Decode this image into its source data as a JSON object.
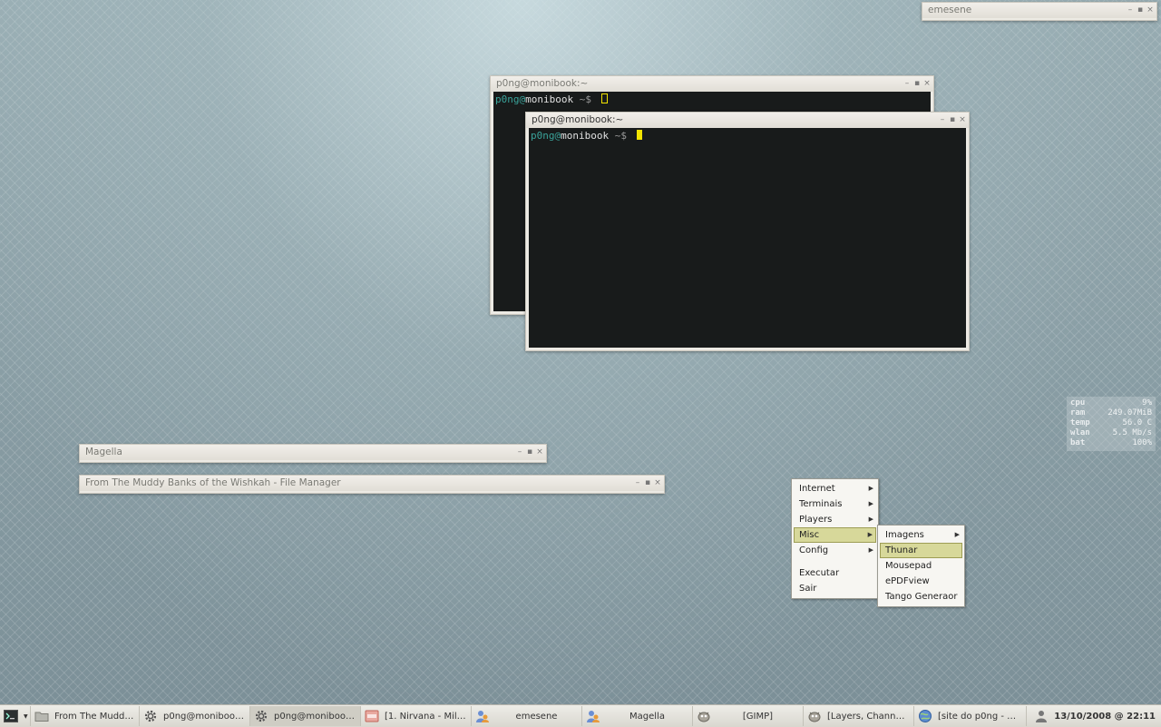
{
  "windows": {
    "emesene": {
      "title": "emesene"
    },
    "term_back": {
      "title": "p0ng@monibook:~",
      "prompt_user": "p0ng@",
      "prompt_host": "monibook",
      "prompt_path": " ~$ "
    },
    "term_front": {
      "title": "p0ng@monibook:~",
      "prompt_user": "p0ng@",
      "prompt_host": "monibook",
      "prompt_path": " ~$ "
    },
    "magella": {
      "title": "Magella"
    },
    "filemanager": {
      "title": "From The Muddy Banks of the Wishkah - File Manager"
    }
  },
  "window_buttons": {
    "minimize": "–",
    "maximize": "▪",
    "close": "×"
  },
  "conky": [
    {
      "key": "cpu",
      "value": "9%"
    },
    {
      "key": "ram",
      "value": "249.07MiB"
    },
    {
      "key": "temp",
      "value": "56.0 C"
    },
    {
      "key": "wlan",
      "value": "5.5 Mb/s"
    },
    {
      "key": "bat",
      "value": "100%"
    }
  ],
  "main_menu": {
    "items": [
      "Internet",
      "Terminais",
      "Players",
      "Misc",
      "Config"
    ],
    "extra": [
      "Executar",
      "Sair"
    ],
    "selected": "Misc"
  },
  "sub_menu": {
    "items": [
      "Imagens",
      "Thunar",
      "Mousepad",
      "ePDFview",
      "Tango Generaor"
    ],
    "selected": "Thunar"
  },
  "taskbar": {
    "items": [
      {
        "label": "From The Muddy ...",
        "icon": "folder-icon"
      },
      {
        "label": "p0ng@monibook:~",
        "icon": "gear-icon"
      },
      {
        "label": "p0ng@monibook:~",
        "icon": "gear-icon",
        "active": true
      },
      {
        "label": "[1. Nirvana - Milk ...",
        "icon": "music-player-icon"
      },
      {
        "label": "emesene",
        "icon": "messenger-icon"
      },
      {
        "label": "Magella",
        "icon": "messenger-icon"
      },
      {
        "label": "[GIMP]",
        "icon": "gimp-icon"
      },
      {
        "label": "[Layers, Channel...",
        "icon": "gimp-icon"
      },
      {
        "label": "[site do p0ng - Gr...",
        "icon": "globe-icon"
      }
    ],
    "clock": "13/10/2008 @ 22:11"
  },
  "colors": {
    "menu_highlight": "#d7d89a",
    "terminal_bg": "#181b1b",
    "cursor": "#f2e300",
    "prompt_user": "#3aa39a"
  }
}
